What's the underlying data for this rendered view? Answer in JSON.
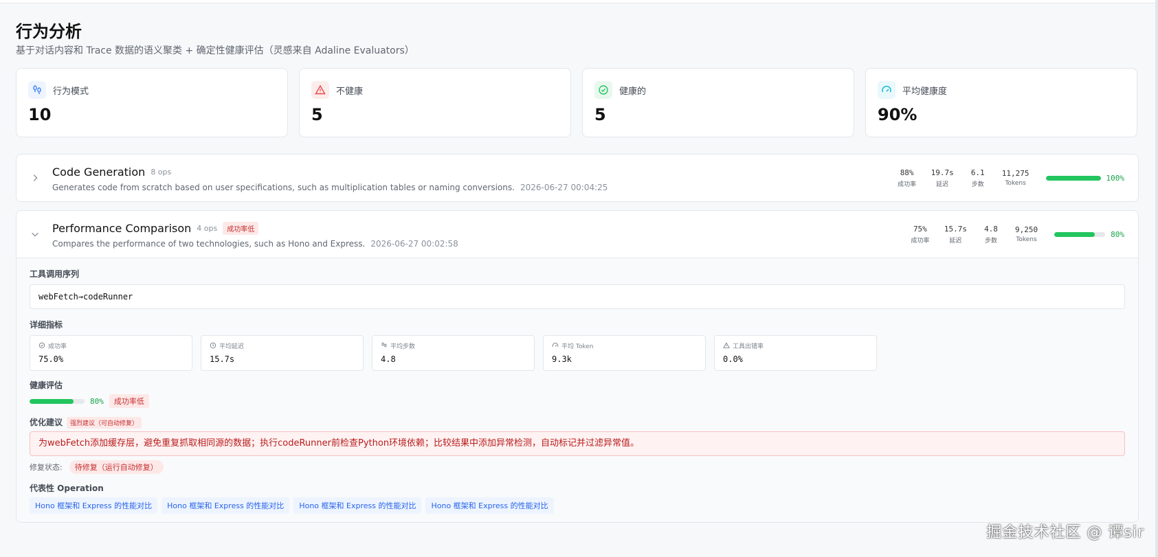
{
  "page": {
    "title": "行为分析",
    "subtitle": "基于对话内容和 Trace 数据的语义聚类 + 确定性健康评估（灵感来自 Adaline Evaluators）"
  },
  "stats": [
    {
      "label": "行为模式",
      "value": "10",
      "icon": "footprints-icon",
      "color": "#3b82f6"
    },
    {
      "label": "不健康",
      "value": "5",
      "icon": "warning-triangle-icon",
      "color": "#ef4444"
    },
    {
      "label": "健康的",
      "value": "5",
      "icon": "check-circle-icon",
      "color": "#22c55e"
    },
    {
      "label": "平均健康度",
      "value": "90%",
      "icon": "gauge-icon",
      "color": "#06b6d4"
    }
  ],
  "behaviors": [
    {
      "title": "Code Generation",
      "ops": "8 ops",
      "desc": "Generates code from scratch based on user specifications, such as multiplication tables or naming conversions.",
      "time": "2026-06-27 00:04:25",
      "metrics": [
        {
          "value": "88%",
          "label": "成功率"
        },
        {
          "value": "19.7s",
          "label": "延迟"
        },
        {
          "value": "6.1",
          "label": "步数"
        },
        {
          "value": "11,275",
          "label": "Tokens"
        }
      ],
      "health": 100,
      "health_label": "100%"
    },
    {
      "title": "Performance Comparison",
      "ops": "4 ops",
      "tag": "成功率低",
      "desc": "Compares the performance of two technologies, such as Hono and Express.",
      "time": "2026-06-27 00:02:58",
      "metrics": [
        {
          "value": "75%",
          "label": "成功率"
        },
        {
          "value": "15.7s",
          "label": "延迟"
        },
        {
          "value": "4.8",
          "label": "步数"
        },
        {
          "value": "9,250",
          "label": "Tokens"
        }
      ],
      "health": 80,
      "health_label": "80%",
      "detail": {
        "seq_title": "工具调用序列",
        "seq": "webFetch→codeRunner",
        "metrics_title": "详细指标",
        "detail_metrics": [
          {
            "label": "成功率",
            "value": "75.0%",
            "icon": "check-circle-icon"
          },
          {
            "label": "平均延迟",
            "value": "15.7s",
            "icon": "clock-icon"
          },
          {
            "label": "平均步数",
            "value": "4.8",
            "icon": "footprints-icon"
          },
          {
            "label": "平均 Token",
            "value": "9.3k",
            "icon": "gauge-icon"
          },
          {
            "label": "工具出错率",
            "value": "0.0%",
            "icon": "warning-triangle-icon"
          }
        ],
        "health_title": "健康评估",
        "health_label": "80%",
        "health_tag": "成功率低",
        "opt_title": "优化建议",
        "opt_tag": "强烈建议（可自动修复）",
        "opt_text": "为webFetch添加缓存层，避免重复抓取相同源的数据；执行codeRunner前检查Python环境依赖；比较结果中添加异常检测，自动标记并过滤异常值。",
        "fix_label": "修复状态:",
        "fix_tag": "待修复（运行自动修复）",
        "ops_title": "代表性 Operation",
        "ops": [
          "Hono 框架和 Express 的性能对比",
          "Hono 框架和 Express 的性能对比",
          "Hono 框架和 Express 的性能对比",
          "Hono 框架和 Express 的性能对比"
        ]
      }
    }
  ],
  "watermark": "掘金技术社区 @ 谭sir"
}
